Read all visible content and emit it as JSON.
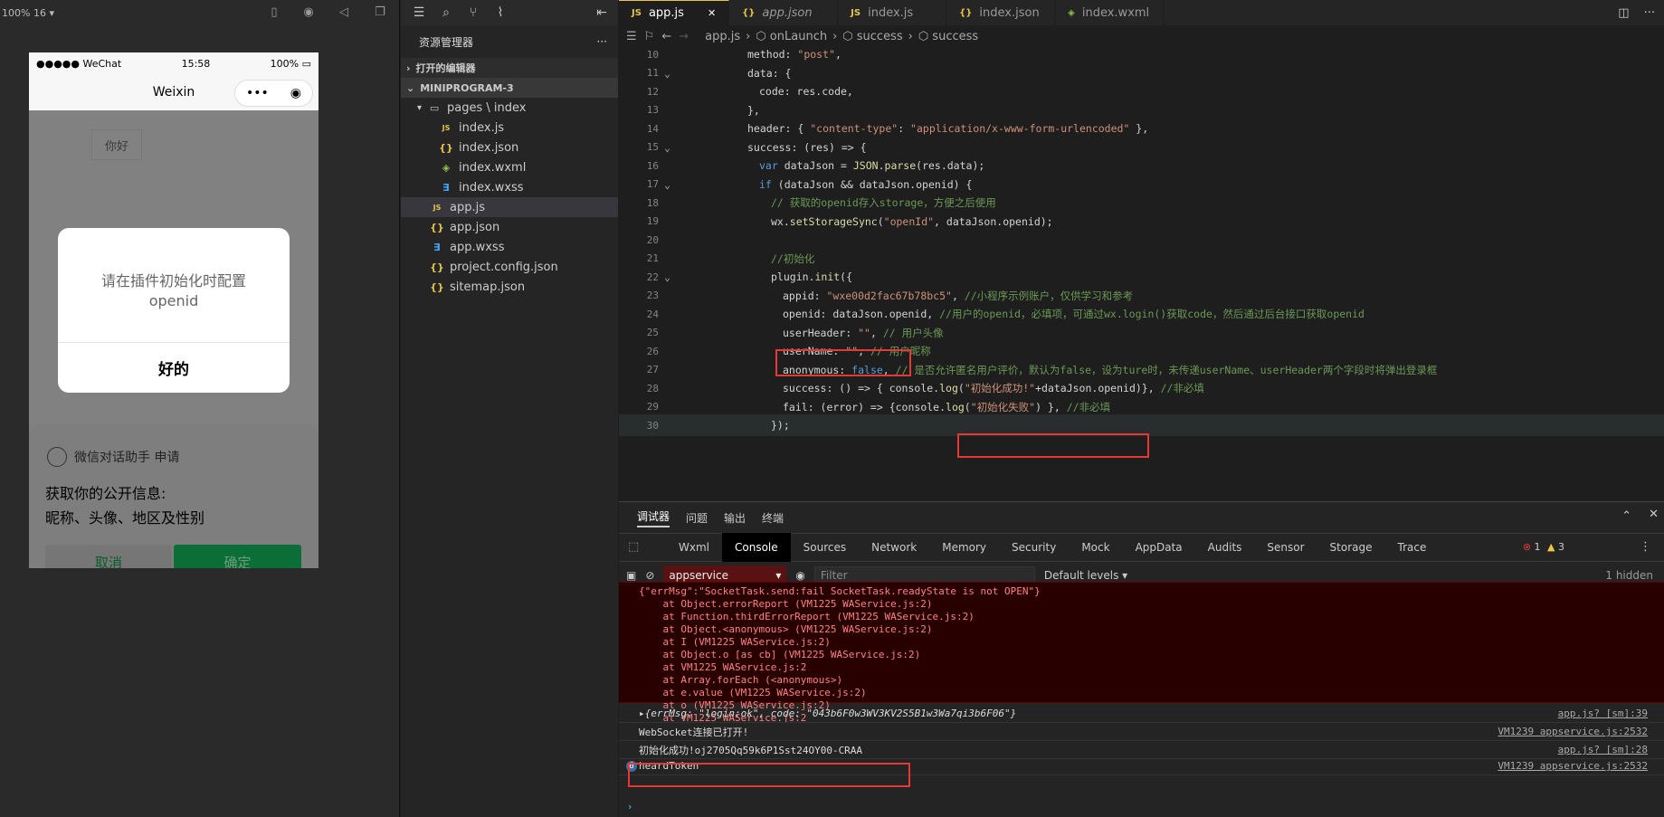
{
  "simulator": {
    "zoom_label": "100% 16 ▾",
    "status": {
      "carrier": "●●●●● WeChat",
      "time": "15:58",
      "battery": "100%"
    },
    "nav_title": "Weixin",
    "hello_button": "你好",
    "modal": {
      "message": "请在插件初始化时配置openid",
      "ok": "好的"
    },
    "auth_sheet": {
      "title": "微信对话助手 申请",
      "info_line1": "获取你的公开信息:",
      "info_line2": "昵称、头像、地区及性别",
      "cancel": "取消",
      "confirm": "确定"
    }
  },
  "explorer": {
    "title": "资源管理器",
    "more": "···",
    "open_editors": "打开的编辑器",
    "project": "MINIPROGRAM-3",
    "folder": "pages \\ index",
    "files": [
      {
        "name": "index.js",
        "type": "js",
        "indent": 2
      },
      {
        "name": "index.json",
        "type": "json",
        "indent": 2
      },
      {
        "name": "index.wxml",
        "type": "wxml",
        "indent": 2
      },
      {
        "name": "index.wxss",
        "type": "wxss",
        "indent": 2
      },
      {
        "name": "app.js",
        "type": "js",
        "indent": 1
      },
      {
        "name": "app.json",
        "type": "json",
        "indent": 1
      },
      {
        "name": "app.wxss",
        "type": "wxss",
        "indent": 1
      },
      {
        "name": "project.config.json",
        "type": "json",
        "indent": 1
      },
      {
        "name": "sitemap.json",
        "type": "json",
        "indent": 1
      }
    ]
  },
  "editor": {
    "tabs": [
      {
        "name": "app.js",
        "type": "js",
        "active": true
      },
      {
        "name": "app.json",
        "type": "json",
        "italic": true
      },
      {
        "name": "index.js",
        "type": "js"
      },
      {
        "name": "index.json",
        "type": "json"
      },
      {
        "name": "index.wxml",
        "type": "wxml"
      }
    ],
    "breadcrumb": [
      "app.js",
      "onLaunch",
      "success",
      "success"
    ],
    "lines": [
      {
        "n": "10",
        "text": "method: \"post\",",
        "indent": 6
      },
      {
        "n": "11",
        "text": "data: {",
        "indent": 6
      },
      {
        "n": "12",
        "text": "code: res.code,",
        "indent": 7
      },
      {
        "n": "13",
        "text": "},",
        "indent": 6
      },
      {
        "n": "14",
        "text": "header: { \"content-type\": \"application/x-www-form-urlencoded\" },",
        "indent": 6
      },
      {
        "n": "15",
        "text": "success: (res) => {",
        "indent": 6
      },
      {
        "n": "16",
        "text": "var dataJson = JSON.parse(res.data);",
        "indent": 7
      },
      {
        "n": "17",
        "text": "if (dataJson && dataJson.openid) {",
        "indent": 7
      },
      {
        "n": "18",
        "text": "// 获取的openid存入storage，方便之后使用",
        "indent": 8
      },
      {
        "n": "19",
        "text": "wx.setStorageSync(\"openId\", dataJson.openid);",
        "indent": 8
      },
      {
        "n": "20",
        "text": "",
        "indent": 8
      },
      {
        "n": "21",
        "text": "//初始化",
        "indent": 8
      },
      {
        "n": "22",
        "text": "plugin.init({",
        "indent": 8
      },
      {
        "n": "23",
        "text": "appid: \"wxe00d2fac67b78bc5\", //小程序示例账户，仅供学习和参考",
        "indent": 9
      },
      {
        "n": "24",
        "text": "openid: dataJson.openid, //用户的openid，必填项，可通过wx.login()获取code，然后通过后台接口获取openid",
        "indent": 9
      },
      {
        "n": "25",
        "text": "userHeader: \"\", // 用户头像",
        "indent": 9
      },
      {
        "n": "26",
        "text": "userName: \"\", // 用户昵称",
        "indent": 9
      },
      {
        "n": "27",
        "text": "anonymous: false, // 是否允许匿名用户评价，默认为false，设为ture时，未传递userName、userHeader两个字段时将弹出登录框",
        "indent": 9
      },
      {
        "n": "28",
        "text": "success: () => { console.log(\"初始化成功!\"+dataJson.openid)}, //非必填",
        "indent": 9
      },
      {
        "n": "29",
        "text": "fail: (error) => {console.log(\"初始化失败\") }, //非必填",
        "indent": 9
      },
      {
        "n": "30",
        "text": "});",
        "indent": 8
      }
    ]
  },
  "devtools": {
    "top_tabs": [
      "调试器",
      "问题",
      "输出",
      "终端"
    ],
    "tabs": [
      "Wxml",
      "Console",
      "Sources",
      "Network",
      "Memory",
      "Security",
      "Mock",
      "AppData",
      "Audits",
      "Sensor",
      "Storage",
      "Trace"
    ],
    "active_tab": "Console",
    "errors": "1",
    "warnings": "3",
    "context": "appservice",
    "filter_placeholder": "Filter",
    "levels": "Default levels ▾",
    "hidden": "1 hidden",
    "error_lines": [
      "{\"errMsg\":\"SocketTask.send:fail SocketTask.readyState is not OPEN\"}",
      "    at Object.errorReport (VM1225 WAService.js:2)",
      "    at Function.thirdErrorReport (VM1225 WAService.js:2)",
      "    at Object.<anonymous> (VM1225 WAService.js:2)",
      "    at I (VM1225 WAService.js:2)",
      "    at Object.o [as cb] (VM1225 WAService.js:2)",
      "    at VM1225 WAService.js:2",
      "    at Array.forEach (<anonymous>)",
      "    at e.value (VM1225 WAService.js:2)",
      "    at o (VM1225 WAService.js:2)",
      "    at VM1225 WAService.js:2"
    ],
    "log_rows": [
      {
        "text": "▸{errMsg: \"login:ok\", code: \"043b6F0w3WV3KV2S5B1w3Wa7qi3b6F06\"}",
        "src": "app.js? [sm]:39"
      },
      {
        "text": "WebSocket连接已打开!",
        "src": "VM1239 appservice.js:2532"
      },
      {
        "text": "初始化成功!oj2705Qq59k6P1Sst24OY00-CRAA",
        "src": "app.js? [sm]:28"
      },
      {
        "text": "heardToken",
        "src": "VM1239 appservice.js:2532",
        "badge": "6"
      }
    ]
  }
}
